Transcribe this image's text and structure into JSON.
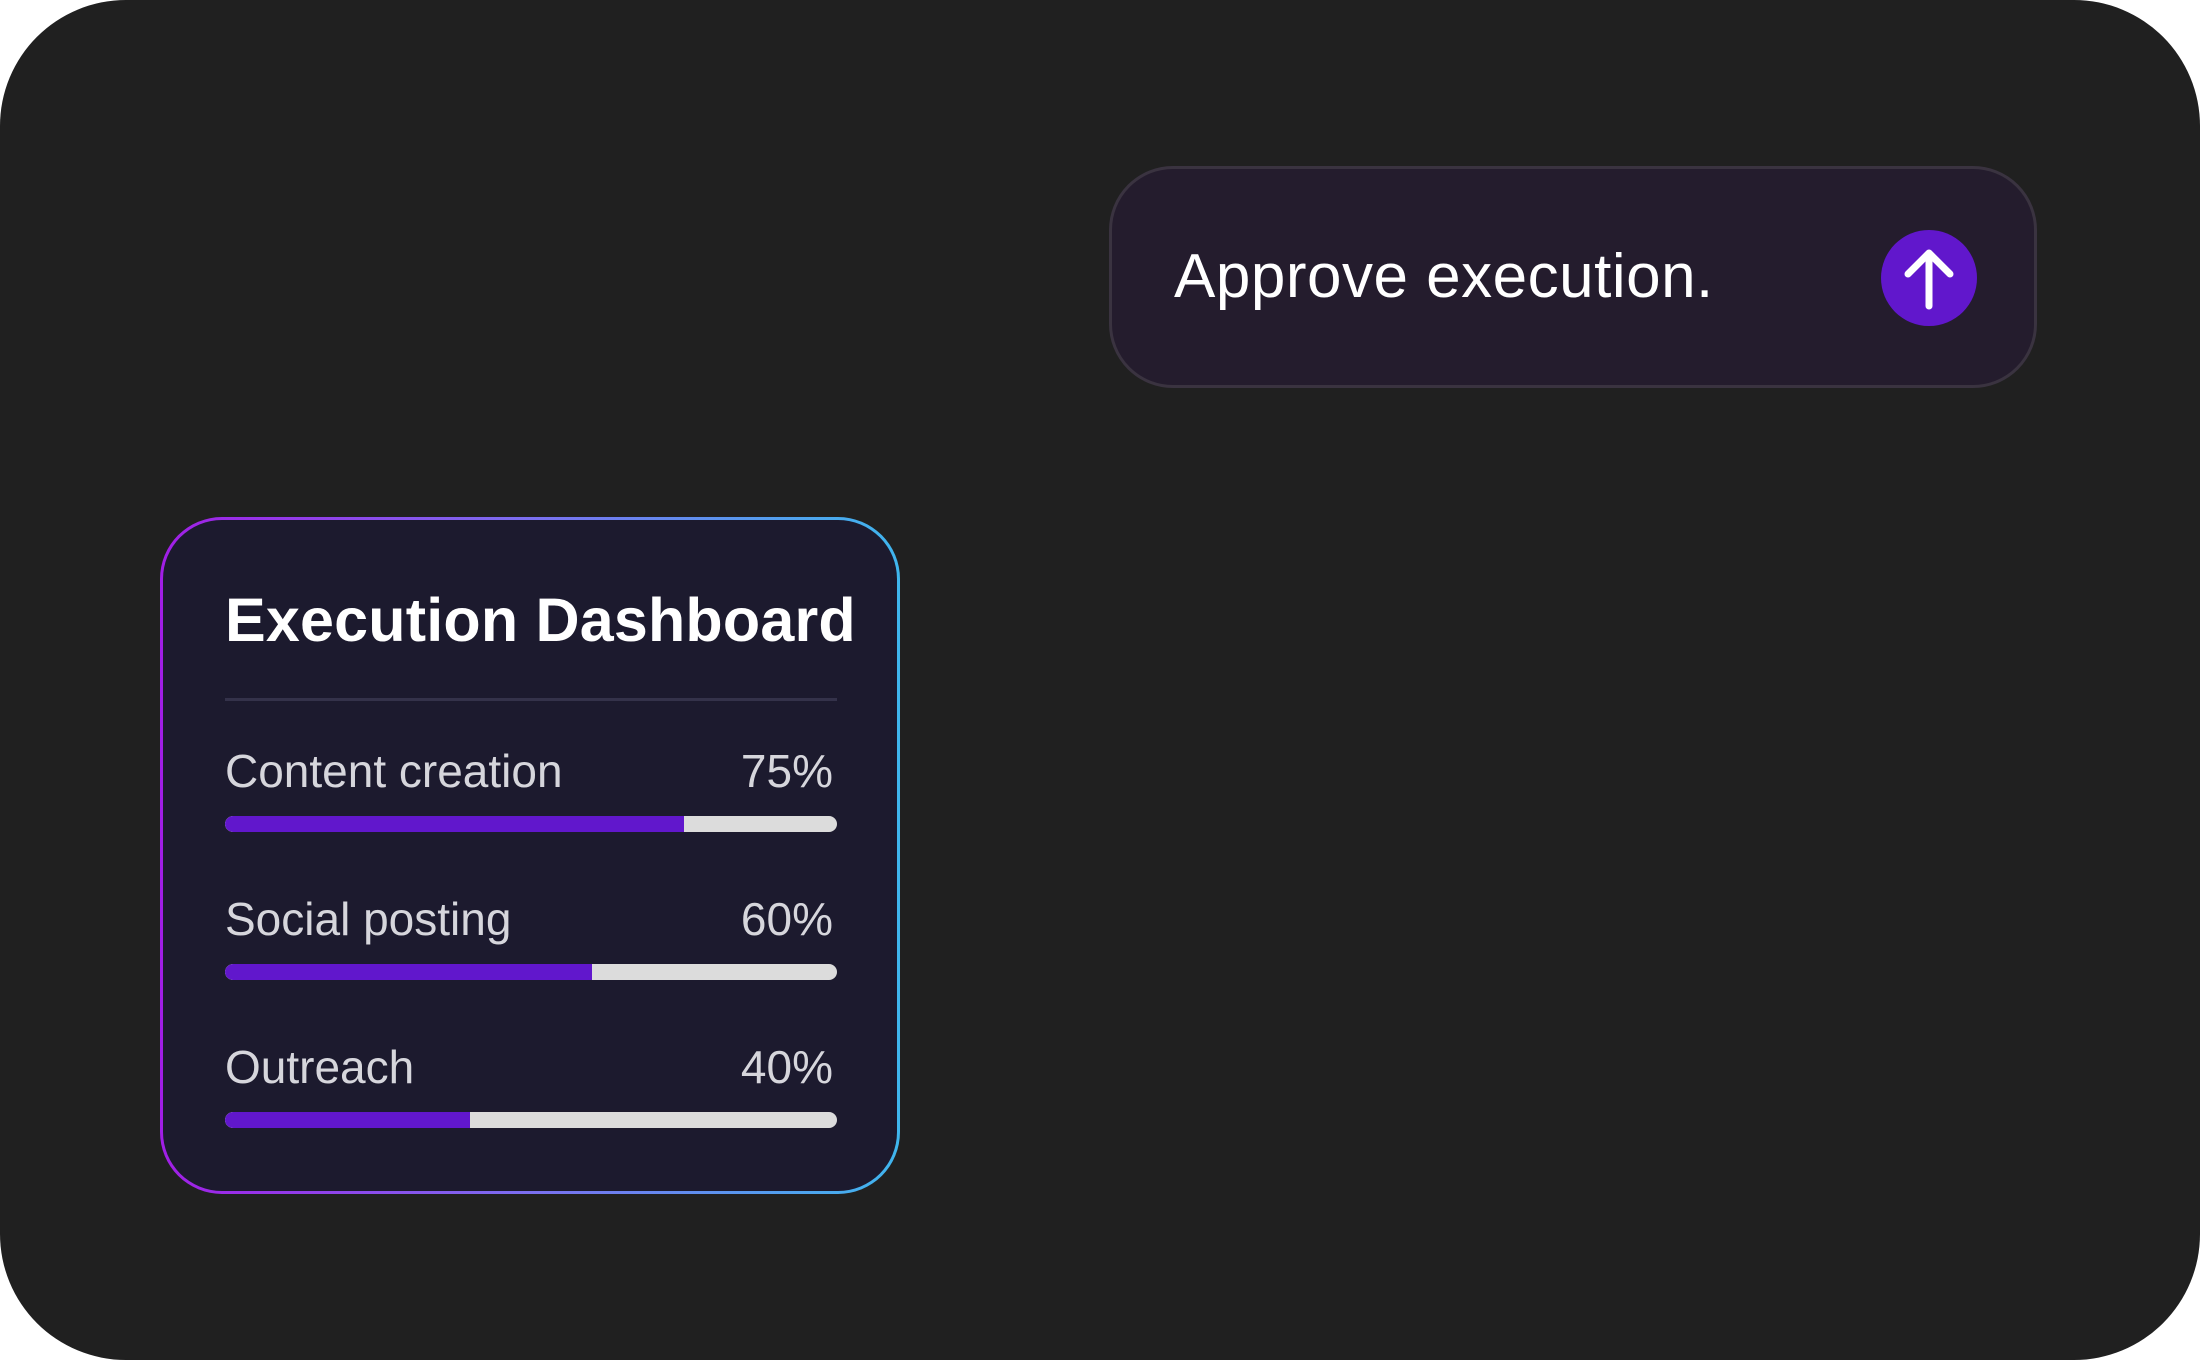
{
  "prompt": {
    "text": "Approve execution.",
    "send_icon": "arrow-up-icon",
    "send_color": "#6117cc"
  },
  "dashboard": {
    "title": "Execution Dashboard",
    "border_gradient": [
      "#a11ee6",
      "#3fb6ee"
    ],
    "tasks": [
      {
        "label": "Content creation",
        "percent_label": "75%",
        "progress": 0.75
      },
      {
        "label": "Social posting",
        "percent_label": "60%",
        "progress": 0.6
      },
      {
        "label": "Outreach",
        "percent_label": "40%",
        "progress": 0.4
      }
    ]
  },
  "colors": {
    "background": "#202020",
    "accent": "#6117cc",
    "track": "#dcdcdc"
  }
}
